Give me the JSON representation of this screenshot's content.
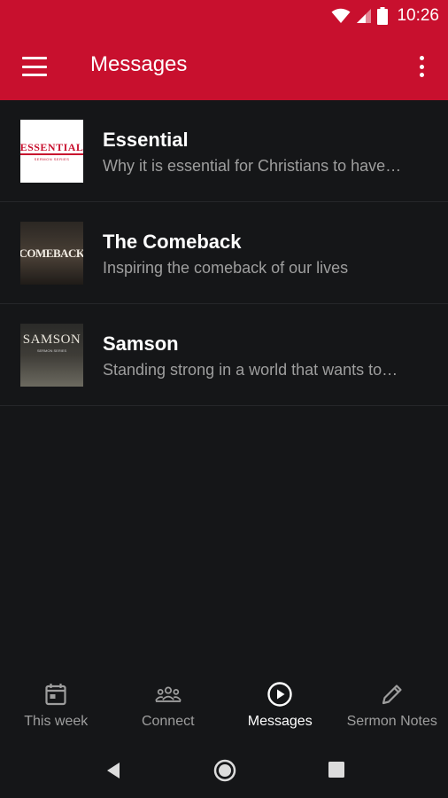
{
  "status_bar": {
    "time": "10:26",
    "icons": [
      "wifi-icon",
      "signal-icon",
      "battery-icon"
    ]
  },
  "app_bar": {
    "title": "Messages",
    "left_icon": "menu-icon",
    "right_icon": "overflow-menu-icon"
  },
  "messages": [
    {
      "title": "Essential",
      "subtitle": "Why it is essential for Christians to have…",
      "thumb_text": "ESSENTIAL",
      "thumb_subtext": "SERMON SERIES"
    },
    {
      "title": "The Comeback",
      "subtitle": "Inspiring the comeback of our lives",
      "thumb_text": "COMEBACK"
    },
    {
      "title": "Samson",
      "subtitle": "Standing strong in a world that wants to…",
      "thumb_text": "SAMSON",
      "thumb_subtext": "SERMON SERIES"
    }
  ],
  "bottom_nav": {
    "items": [
      {
        "label": "This week",
        "icon": "calendar-icon",
        "active": false
      },
      {
        "label": "Connect",
        "icon": "people-icon",
        "active": false
      },
      {
        "label": "Messages",
        "icon": "play-circle-icon",
        "active": true
      },
      {
        "label": "Sermon Notes",
        "icon": "pencil-icon",
        "active": false
      }
    ]
  },
  "system_nav": {
    "icons": [
      "back-icon",
      "home-icon",
      "recents-icon"
    ]
  },
  "colors": {
    "primary": "#c8102e",
    "background": "#151618",
    "text_primary": "#ffffff",
    "text_secondary": "#9e9e9e"
  }
}
